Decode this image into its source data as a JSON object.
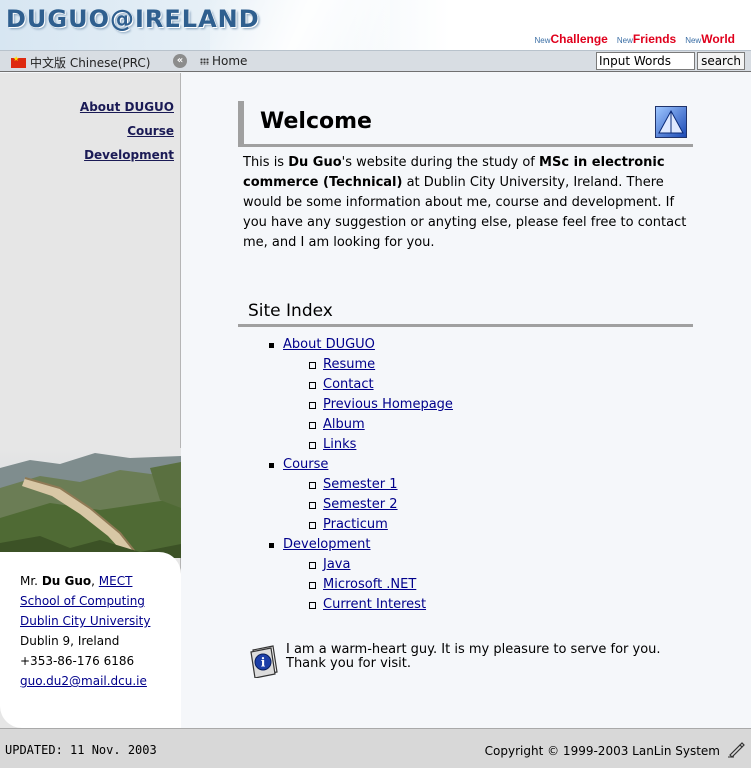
{
  "header": {
    "logo": "DUGUO@IRELAND",
    "links": [
      {
        "prefix": "New",
        "label": "Challenge"
      },
      {
        "prefix": "New",
        "label": "Friends"
      },
      {
        "prefix": "New",
        "label": "World"
      }
    ]
  },
  "toolbar": {
    "language": "中文版 Chinese(PRC)",
    "home": "Home",
    "search_value": "Input Words",
    "search_button": "search"
  },
  "sidebar": {
    "nav": [
      "About DUGUO",
      "Course",
      "Development"
    ],
    "card": {
      "title_prefix": "Mr.",
      "name": "Du Guo",
      "program": "MECT",
      "school": "School of Computing",
      "university": "Dublin City University",
      "address": "Dublin 9, Ireland",
      "phone": "+353-86-176 6186",
      "email": "guo.du2@mail.dcu.ie"
    }
  },
  "main": {
    "welcome_title": "Welcome",
    "intro": {
      "p1": "This is ",
      "name": "Du Guo",
      "p2": "'s website during the study of ",
      "degree": "MSc in electronic commerce (Technical)",
      "p3": " at Dublin City University, Ireland. There would be some information about me, course and development. If you have any suggestion or anyting else, please feel free to contact me, and I am looking for you."
    },
    "site_index_title": "Site Index",
    "index": [
      {
        "label": "About DUGUO",
        "children": [
          "Resume",
          "Contact",
          "Previous Homepage",
          "Album",
          "Links"
        ]
      },
      {
        "label": "Course",
        "children": [
          "Semester 1",
          "Semester 2",
          "Practicum"
        ]
      },
      {
        "label": "Development",
        "children": [
          "Java",
          "Microsoft .NET",
          "Current Interest"
        ]
      }
    ],
    "footer_message": "I am a warm-heart guy. It is my pleasure to serve for you. Thank you for visit."
  },
  "footer": {
    "updated": "UPDATED: 11 Nov. 2003",
    "copyright": "Copyright © 1999-2003  LanLin System"
  },
  "colors": {
    "logo": "#2f5f8f",
    "header_link": "#e0001c",
    "link": "#00008b",
    "rule": "#a0a0a0"
  }
}
